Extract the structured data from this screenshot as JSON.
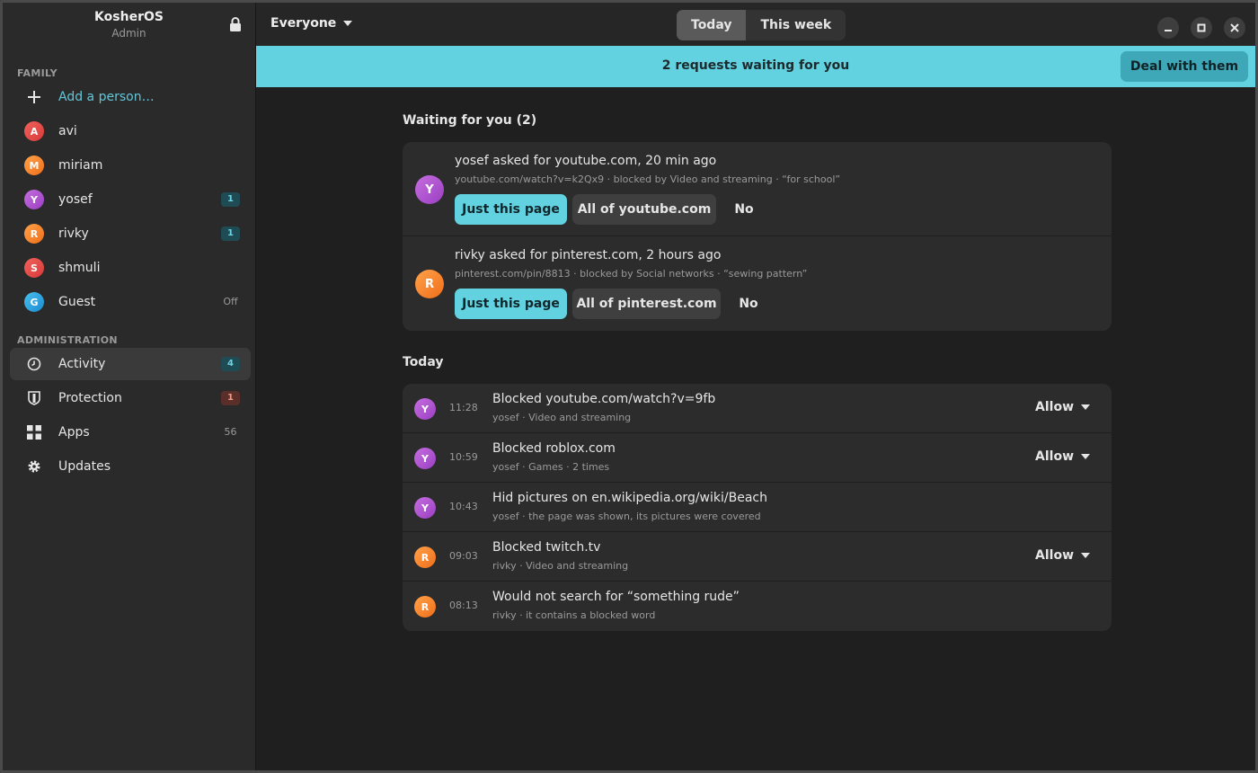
{
  "sidebar": {
    "title": "KosherOS",
    "subtitle": "Admin",
    "family_label": "FAMILY",
    "add_person": "Add a person…",
    "people": [
      {
        "initial": "A",
        "name": "avi",
        "badge": ""
      },
      {
        "initial": "M",
        "name": "miriam",
        "badge": ""
      },
      {
        "initial": "Y",
        "name": "yosef",
        "badge": "1"
      },
      {
        "initial": "R",
        "name": "rivky",
        "badge": "1"
      },
      {
        "initial": "S",
        "name": "shmuli",
        "badge": ""
      },
      {
        "initial": "G",
        "name": "Guest",
        "badge": "Off"
      }
    ],
    "admin_label": "ADMINISTRATION",
    "admin": [
      {
        "icon": "clock-icon",
        "label": "Activity",
        "badge": "4"
      },
      {
        "icon": "shield-icon",
        "label": "Protection",
        "badge": "1"
      },
      {
        "icon": "apps-grid-icon",
        "label": "Apps",
        "badge": "56"
      },
      {
        "icon": "gear-icon",
        "label": "Updates",
        "badge": ""
      }
    ]
  },
  "header": {
    "filter": "Everyone",
    "tabs": [
      "Today",
      "This week"
    ],
    "active_tab": "Today"
  },
  "banner": {
    "text": "2 requests waiting for you",
    "button": "Deal with them"
  },
  "waiting": {
    "heading": "Waiting for you (2)",
    "requests": [
      {
        "initial": "Y",
        "title": "yosef asked for youtube.com, 20 min ago",
        "detail": "youtube.com/watch?v=k2Qx9 · blocked by Video and streaming · “for school”",
        "btn_page": "Just this page",
        "btn_site": "All of youtube.com",
        "btn_no": "No"
      },
      {
        "initial": "R",
        "title": "rivky asked for pinterest.com, 2 hours ago",
        "detail": "pinterest.com/pin/8813 · blocked by Social networks · “sewing pattern”",
        "btn_page": "Just this page",
        "btn_site": "All of pinterest.com",
        "btn_no": "No"
      }
    ]
  },
  "today": {
    "heading": "Today",
    "items": [
      {
        "initial": "Y",
        "time": "11:28",
        "title": "Blocked youtube.com/watch?v=9fb",
        "sub": "yosef · Video and streaming",
        "action": "Allow"
      },
      {
        "initial": "Y",
        "time": "10:59",
        "title": "Blocked roblox.com",
        "sub": "yosef · Games · 2 times",
        "action": "Allow"
      },
      {
        "initial": "Y",
        "time": "10:43",
        "title": "Hid pictures on en.wikipedia.org/wiki/Beach",
        "sub": "yosef · the page was shown, its pictures were covered",
        "action": ""
      },
      {
        "initial": "R",
        "time": "09:03",
        "title": "Blocked twitch.tv",
        "sub": "rivky · Video and streaming",
        "action": "Allow"
      },
      {
        "initial": "R",
        "time": "08:13",
        "title": "Would not search for “something rude”",
        "sub": "rivky · it contains a blocked word",
        "action": ""
      }
    ]
  },
  "colors": {
    "accent": "#63d2e0",
    "sidebar_bg": "#2a2a2a",
    "main_bg": "#1f1f1f",
    "card_bg": "#2c2c2c"
  }
}
